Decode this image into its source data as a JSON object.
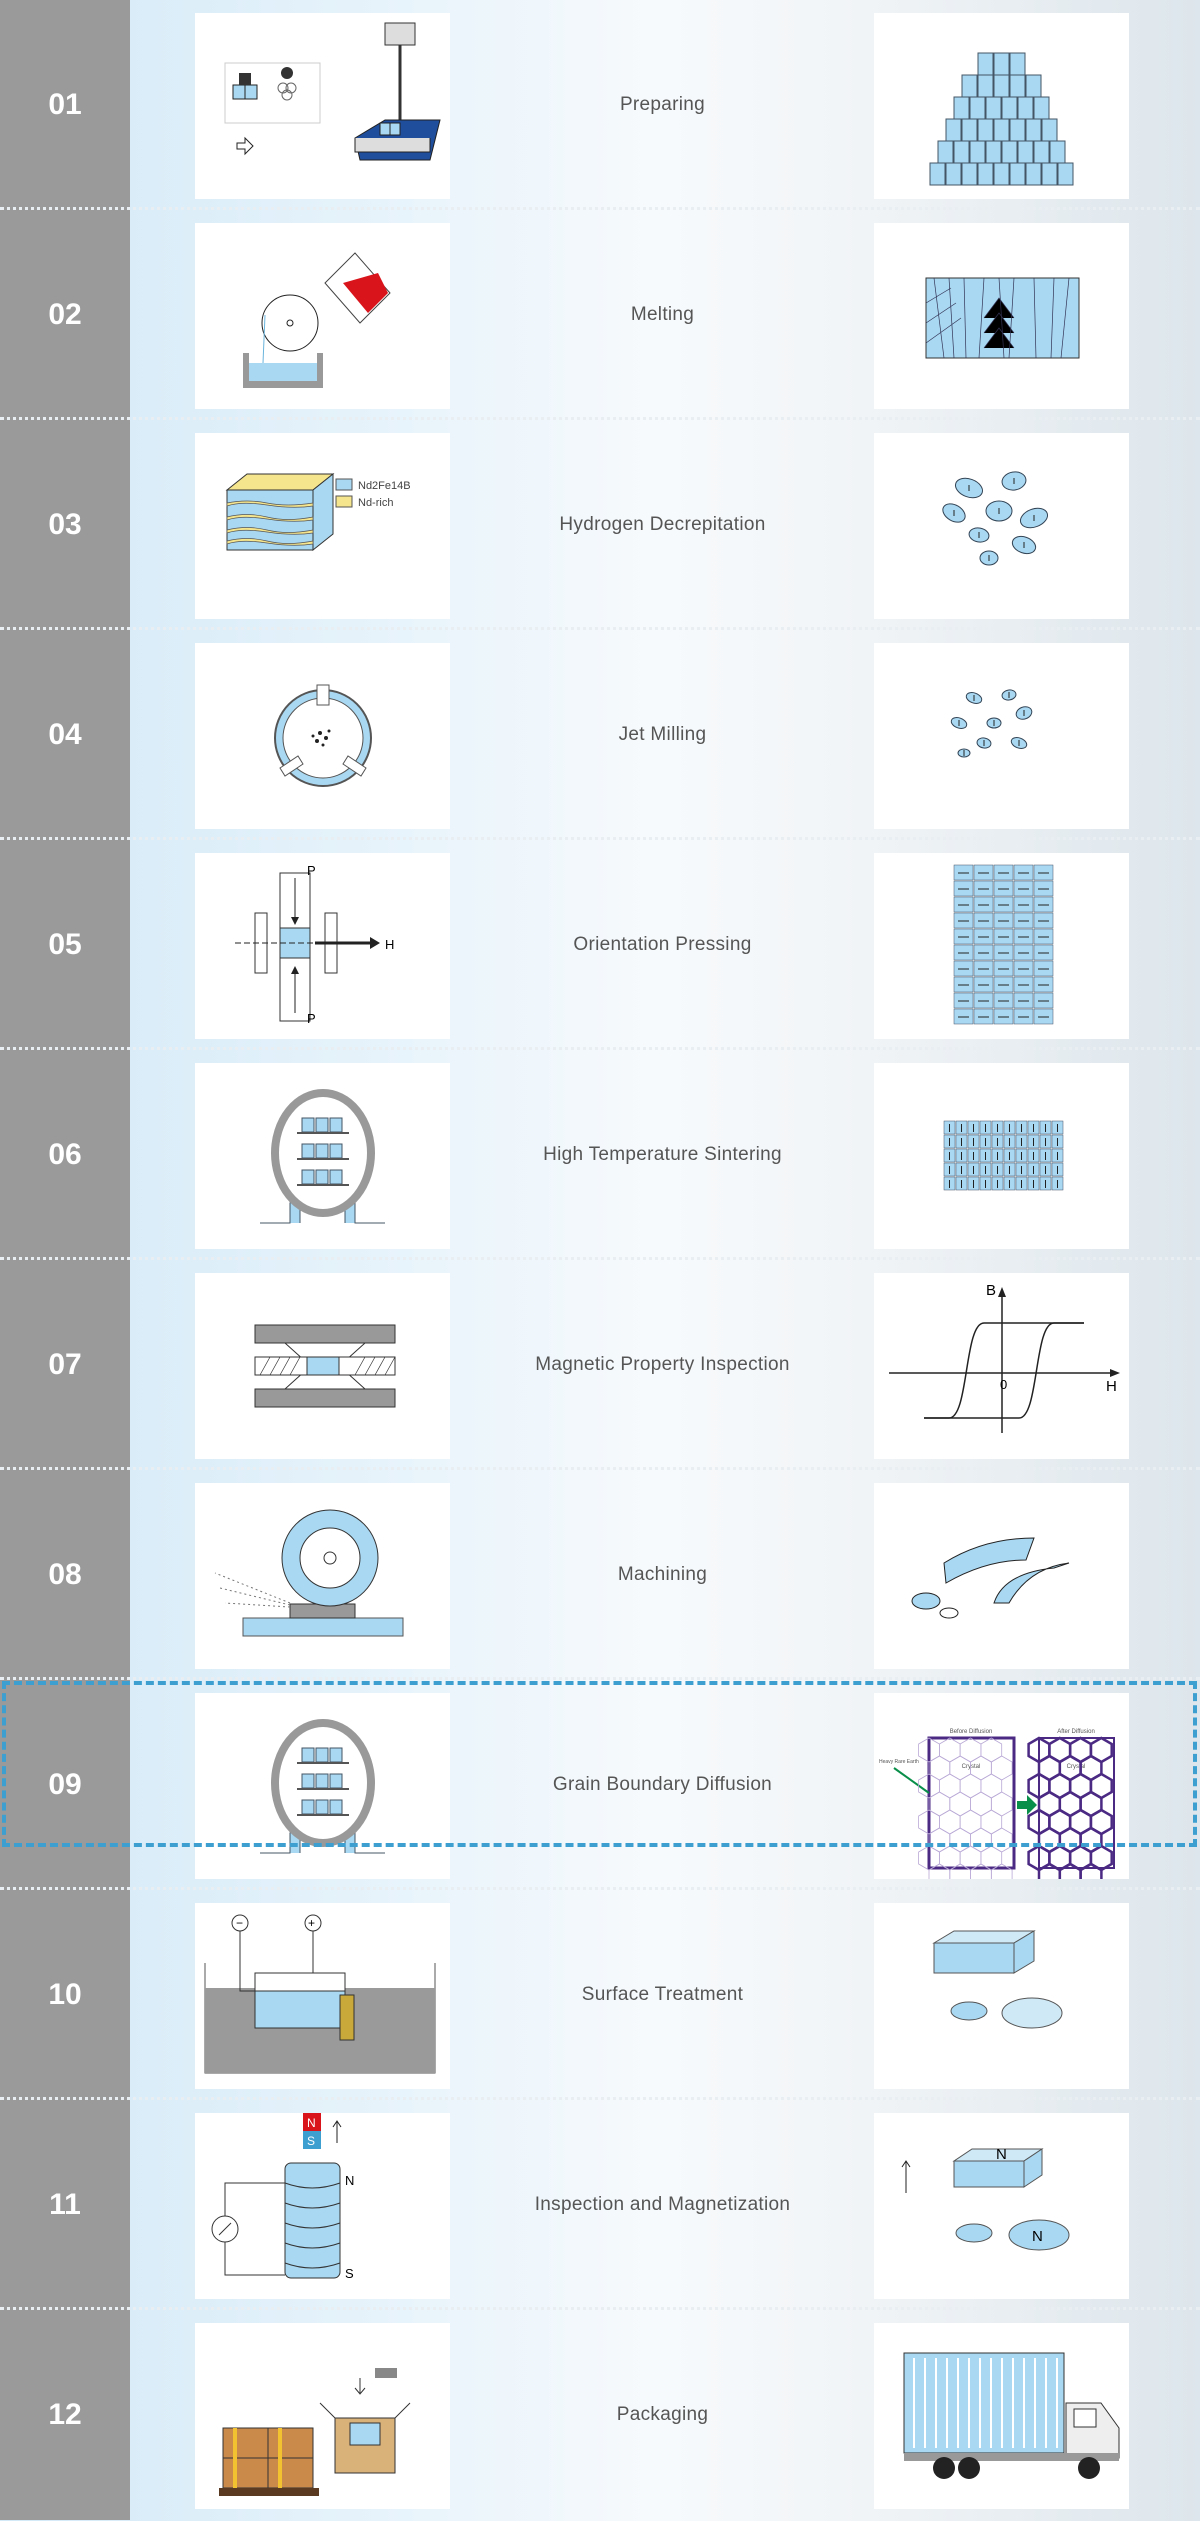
{
  "steps": [
    {
      "number": "01",
      "label": "Preparing"
    },
    {
      "number": "02",
      "label": "Melting"
    },
    {
      "number": "03",
      "label": "Hydrogen Decrepitation"
    },
    {
      "number": "04",
      "label": "Jet Milling"
    },
    {
      "number": "05",
      "label": "Orientation Pressing"
    },
    {
      "number": "06",
      "label": "High Temperature Sintering"
    },
    {
      "number": "07",
      "label": "Magnetic Property Inspection"
    },
    {
      "number": "08",
      "label": "Machining"
    },
    {
      "number": "09",
      "label": "Grain Boundary Diffusion"
    },
    {
      "number": "10",
      "label": "Surface Treatment"
    },
    {
      "number": "11",
      "label": "Inspection and Magnetization"
    },
    {
      "number": "12",
      "label": "Packaging"
    }
  ],
  "illustration_text": {
    "legend_main_phase": "Nd2Fe14B",
    "legend_nd_rich": "Nd-rich",
    "pressure": "P",
    "field": "H",
    "axis_b": "B",
    "axis_h": "H",
    "origin": "0",
    "north": "N",
    "south": "S",
    "before_diffusion": "Before Diffusion",
    "after_diffusion": "After Diffusion",
    "crystal": "Crystal",
    "heavy_rare_earth": "Heavy Rare Earth"
  },
  "colors": {
    "number_column": "#9a9a9a",
    "highlight": "#3d9fd0",
    "material": "#a9d8f2",
    "scale": "#1f4e9c",
    "red": "#d9141b",
    "purple": "#4b2a84"
  }
}
